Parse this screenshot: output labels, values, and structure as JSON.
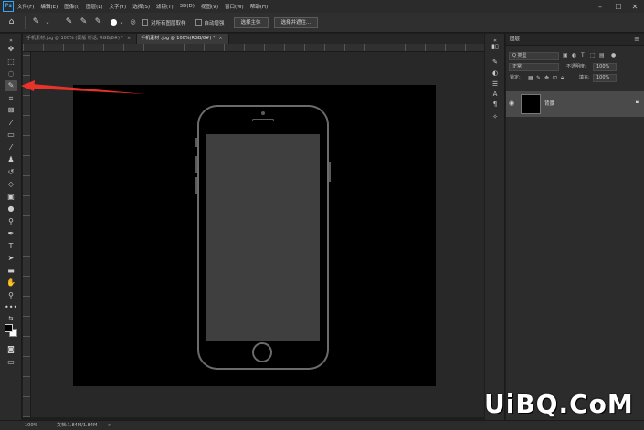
{
  "app": {
    "logo": "Ps",
    "menu": [
      "文件(F)",
      "编辑(E)",
      "图像(I)",
      "图层(L)",
      "文字(Y)",
      "选择(S)",
      "滤镜(T)",
      "3D(D)",
      "视图(V)",
      "窗口(W)",
      "帮助(H)"
    ],
    "window_controls": {
      "minimize": "–",
      "maximize": "☐",
      "close": "✕"
    }
  },
  "options": {
    "sample_all_layers": "对所有图层取样",
    "auto_enhance": "自动增强",
    "select_subject": "选择主体",
    "select_and_mask": "选择并遮住..."
  },
  "tabs": [
    {
      "label": "手机素材.jpg @ 100% (蒙版 桥话, RGB/8#) *",
      "close": "×"
    },
    {
      "label": "手机素材 .jpg @ 100%(RGB/8#) *",
      "close": "×"
    }
  ],
  "layers_panel": {
    "title": "图层",
    "menu_icon": "≡",
    "filter_kind": "Q 类型",
    "blend_mode": "正常",
    "opacity_label": "不透明度:",
    "opacity_value": "100%",
    "lock_label": "锁定:",
    "fill_label": "填充:",
    "fill_value": "100%",
    "layers": [
      {
        "name": "背景",
        "visible": true,
        "locked": true
      }
    ]
  },
  "status": {
    "zoom": "100%",
    "doc_size": "文档:1.84M/1.84M",
    "arrow": ">"
  },
  "watermark": "UiBQ.CoM",
  "colors": {
    "arrow": "#e8322a",
    "accent": "#31a8ff",
    "foreground": "#000000",
    "background": "#ffffff"
  }
}
